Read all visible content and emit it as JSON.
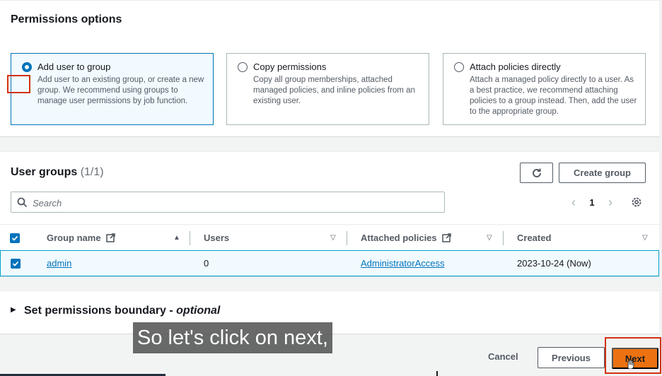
{
  "permissions": {
    "title": "Permissions options",
    "options": [
      {
        "label": "Add user to group",
        "description": "Add user to an existing group, or create a new group. We recommend using groups to manage user permissions by job function.",
        "selected": true
      },
      {
        "label": "Copy permissions",
        "description": "Copy all group memberships, attached managed policies, and inline policies from an existing user.",
        "selected": false
      },
      {
        "label": "Attach policies directly",
        "description": "Attach a managed policy directly to a user. As a best practice, we recommend attaching policies to a group instead. Then, add the user to the appropriate group.",
        "selected": false
      }
    ]
  },
  "user_groups": {
    "title": "User groups",
    "count": "(1/1)",
    "create_group_label": "Create group",
    "refresh_icon": "refresh-icon",
    "search_placeholder": "Search",
    "page": "1",
    "columns": [
      "Group name",
      "Users",
      "Attached policies",
      "Created"
    ],
    "rows": [
      {
        "checked": true,
        "group_name": "admin",
        "users": "0",
        "attached_policies": "AdministratorAccess",
        "created": "2023-10-24 (Now)"
      }
    ]
  },
  "boundary": {
    "title": "Set permissions boundary - ",
    "optional": "optional"
  },
  "caption": "So let's click on next,",
  "footer": {
    "cancel_label": "Cancel",
    "previous_label": "Previous",
    "next_label": "Next"
  },
  "colors": {
    "accent": "#0073bb",
    "primary_button": "#ec7211",
    "highlight": "#d13212"
  }
}
